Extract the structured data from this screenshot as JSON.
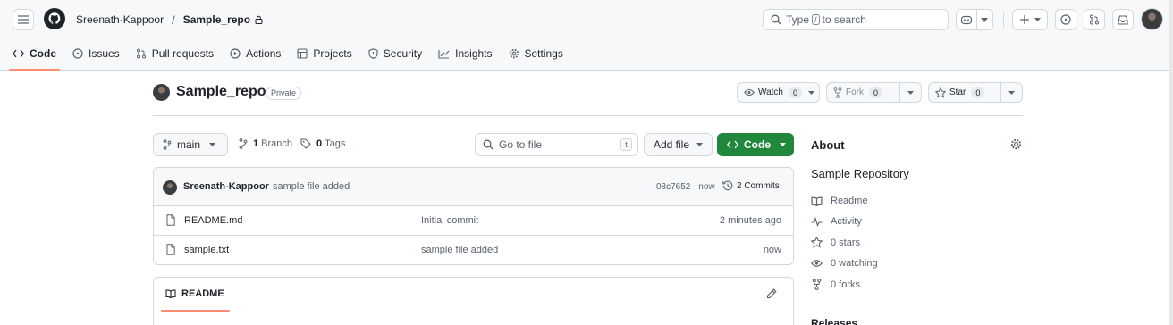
{
  "header": {
    "owner": "Sreenath-Kappoor",
    "separator": "/",
    "repo": "Sample_repo",
    "search": {
      "prefix": "Type",
      "key": "/",
      "suffix": "to search"
    }
  },
  "nav": {
    "tabs": [
      {
        "label": "Code",
        "icon": "code-icon",
        "active": true
      },
      {
        "label": "Issues",
        "icon": "issue-icon"
      },
      {
        "label": "Pull requests",
        "icon": "pull-request-icon"
      },
      {
        "label": "Actions",
        "icon": "play-icon"
      },
      {
        "label": "Projects",
        "icon": "table-icon"
      },
      {
        "label": "Security",
        "icon": "shield-icon"
      },
      {
        "label": "Insights",
        "icon": "graph-icon"
      },
      {
        "label": "Settings",
        "icon": "gear-icon"
      }
    ]
  },
  "repo": {
    "title": "Sample_repo",
    "visibility": "Private",
    "watch": {
      "label": "Watch",
      "count": "0"
    },
    "fork": {
      "label": "Fork",
      "count": "0"
    },
    "star": {
      "label": "Star",
      "count": "0"
    }
  },
  "toolbar": {
    "branch": "main",
    "branches_count": "1",
    "branches_label": "Branch",
    "tags_count": "0",
    "tags_label": "Tags",
    "goto_placeholder": "Go to file",
    "goto_key": "t",
    "add_file": "Add file",
    "code": "Code"
  },
  "commit": {
    "author": "Sreenath-Kappoor",
    "message": "sample file added",
    "sha_time": "08c7652 · now",
    "commits_label": "2 Commits"
  },
  "files": [
    {
      "name": "README.md",
      "message": "Initial commit",
      "age": "2 minutes ago"
    },
    {
      "name": "sample.txt",
      "message": "sample file added",
      "age": "now"
    }
  ],
  "readme": {
    "tab": "README"
  },
  "about": {
    "title": "About",
    "description": "Sample Repository",
    "items": [
      {
        "label": "Readme",
        "icon": "book-icon"
      },
      {
        "label": "Activity",
        "icon": "pulse-icon"
      },
      {
        "label": "0 stars",
        "icon": "star-icon"
      },
      {
        "label": "0 watching",
        "icon": "eye-icon"
      },
      {
        "label": "0 forks",
        "icon": "fork-icon"
      }
    ],
    "releases": "Releases"
  },
  "colors": {
    "accent_underline": "#fd8c73",
    "code_button": "#1f883d",
    "border": "#d1d9e0",
    "muted_text": "#59636e"
  }
}
